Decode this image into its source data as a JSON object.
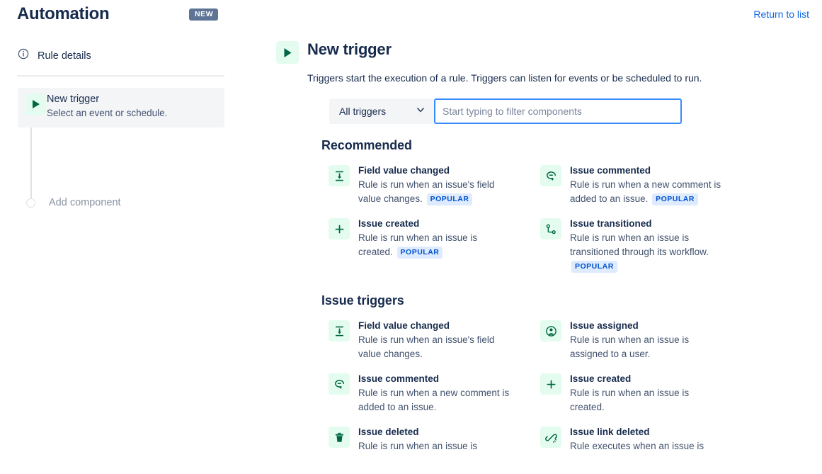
{
  "header": {
    "title": "Automation",
    "new_badge": "NEW",
    "return_link": "Return to list"
  },
  "sidebar": {
    "rule_details": {
      "label": "Rule details",
      "icon": "info-circle-icon"
    },
    "new_trigger": {
      "title": "New trigger",
      "subtitle": "Select an event or schedule.",
      "icon": "play-triangle-icon"
    },
    "add_component": {
      "label": "Add component",
      "icon": "empty-circle-icon"
    }
  },
  "main": {
    "icon": "play-triangle-icon",
    "title": "New trigger",
    "description": "Triggers start the execution of a rule. Triggers can listen for events or be scheduled to run.",
    "filter": {
      "select_value": "All triggers",
      "select_icon": "chevron-down-icon",
      "search_placeholder": "Start typing to filter components",
      "search_value": ""
    },
    "sections": [
      {
        "title": "Recommended",
        "items": [
          {
            "title": "Field value changed",
            "desc": "Rule is run when an issue's field value changes.",
            "badge": "POPULAR",
            "icon": "field-value-changed-icon"
          },
          {
            "title": "Issue commented",
            "desc": "Rule is run when a new comment is added to an issue.",
            "badge": "POPULAR",
            "icon": "comment-icon"
          },
          {
            "title": "Issue created",
            "desc": "Rule is run when an issue is created.",
            "badge": "POPULAR",
            "icon": "plus-icon"
          },
          {
            "title": "Issue transitioned",
            "desc": "Rule is run when an issue is transitioned through its workflow.",
            "badge": "POPULAR",
            "icon": "transition-branch-icon"
          }
        ]
      },
      {
        "title": "Issue triggers",
        "items": [
          {
            "title": "Field value changed",
            "desc": "Rule is run when an issue's field value changes.",
            "badge": "",
            "icon": "field-value-changed-icon"
          },
          {
            "title": "Issue assigned",
            "desc": "Rule is run when an issue is assigned to a user.",
            "badge": "",
            "icon": "person-circle-icon"
          },
          {
            "title": "Issue commented",
            "desc": "Rule is run when a new comment is added to an issue.",
            "badge": "",
            "icon": "comment-icon"
          },
          {
            "title": "Issue created",
            "desc": "Rule is run when an issue is created.",
            "badge": "",
            "icon": "plus-icon"
          },
          {
            "title": "Issue deleted",
            "desc": "Rule is run when an issue is",
            "badge": "",
            "icon": "trash-icon"
          },
          {
            "title": "Issue link deleted",
            "desc": "Rule executes when an issue is",
            "badge": "",
            "icon": "broken-link-icon"
          }
        ]
      }
    ]
  },
  "colors": {
    "accent_green": "#E3FCEF",
    "icon_green": "#006644",
    "link_blue": "#0C66E4",
    "badge_blue_bg": "#DEEBFF",
    "badge_blue_text": "#0052CC",
    "new_badge_bg": "#5E7496",
    "focus_border": "#388BFF",
    "text_primary": "#172B4D",
    "text_secondary": "#42526E"
  }
}
